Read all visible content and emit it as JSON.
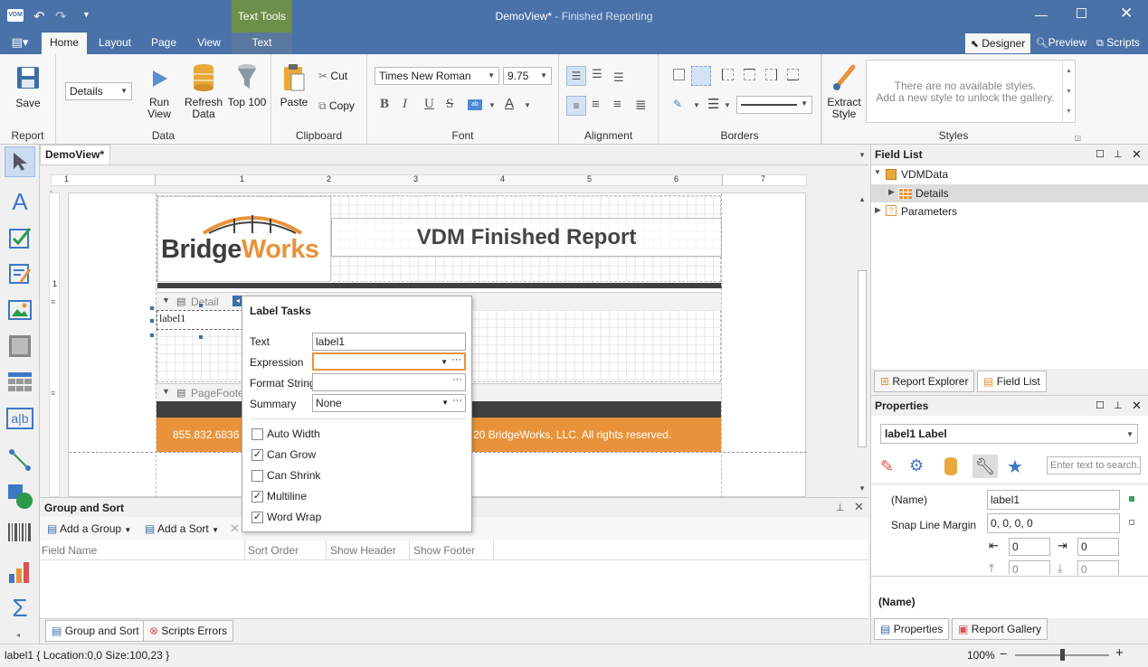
{
  "titlebar": {
    "app_icon": "VDM",
    "title_doc": "DemoView*",
    "title_sep": " - ",
    "title_app": "Finished Reporting",
    "context_tab": "Text Tools"
  },
  "ribbon_tabs": {
    "home": "Home",
    "layout": "Layout",
    "page": "Page",
    "view": "View",
    "text": "Text",
    "designer": "Designer",
    "preview": "Preview",
    "scripts": "Scripts"
  },
  "ribbon": {
    "report": {
      "save": "Save",
      "group": "Report"
    },
    "data": {
      "dropdown": "Details",
      "run_view": "Run View",
      "refresh_1": "Refresh",
      "refresh_2": "Data",
      "top100": "Top 100",
      "group": "Data"
    },
    "clipboard": {
      "paste": "Paste",
      "cut": "Cut",
      "copy": "Copy",
      "group": "Clipboard"
    },
    "font": {
      "family": "Times New Roman",
      "size": "9.75",
      "bold": "B",
      "italic": "I",
      "underline": "U",
      "strike": "S",
      "group": "Font"
    },
    "alignment": {
      "group": "Alignment"
    },
    "borders": {
      "group": "Borders"
    },
    "extract": {
      "line1": "Extract",
      "line2": "Style"
    },
    "styles": {
      "empty1": "There are no available styles.",
      "empty2": "Add a new style to unlock the gallery.",
      "group": "Styles"
    }
  },
  "document": {
    "tab": "DemoView*",
    "ruler": [
      "1",
      "1",
      "2",
      "3",
      "4",
      "5",
      "6",
      "7"
    ],
    "vruler": [
      "1"
    ]
  },
  "report": {
    "logo_bridge": "Bridge",
    "logo_works": "Works",
    "title": "VDM Finished Report",
    "band_detail": "Detail",
    "band_footer": "PageFooter",
    "label": "label1",
    "footer_phone": "855.832.6836",
    "footer_copy": "20 BridgeWorks, LLC. All rights reserved.",
    "accent": "#e8933a"
  },
  "tasks": {
    "title": "Label Tasks",
    "text_label": "Text",
    "text_value": "label1",
    "expression_label": "Expression",
    "format_label": "Format String",
    "summary_label": "Summary",
    "summary_value": "None",
    "auto_width": "Auto Width",
    "can_grow": "Can Grow",
    "can_shrink": "Can Shrink",
    "multiline": "Multiline",
    "word_wrap": "Word Wrap"
  },
  "group_sort": {
    "title": "Group and Sort",
    "add_group": "Add a Group",
    "add_sort": "Add a Sort",
    "col_field": "Field Name",
    "col_order": "Sort Order",
    "col_header": "Show Header",
    "col_footer": "Show Footer",
    "tab1": "Group and Sort",
    "tab2": "Scripts Errors"
  },
  "field_list": {
    "title": "Field List",
    "root": "VDMData",
    "child": "Details",
    "params": "Parameters",
    "tab1": "Report Explorer",
    "tab2": "Field List"
  },
  "properties": {
    "title": "Properties",
    "selector": "label1   Label",
    "search_placeholder": "Enter text to search...",
    "name_label": "(Name)",
    "name_value": "label1",
    "snap_label": "Snap Line Margin",
    "snap_value": "0, 0, 0, 0",
    "m1": "0",
    "m2": "0",
    "m3": "0",
    "m4": "0",
    "desc": "(Name)",
    "tab1": "Properties",
    "tab2": "Report Gallery"
  },
  "status": {
    "text": "label1 { Location:0,0 Size:100,23 }",
    "zoom": "100%"
  }
}
